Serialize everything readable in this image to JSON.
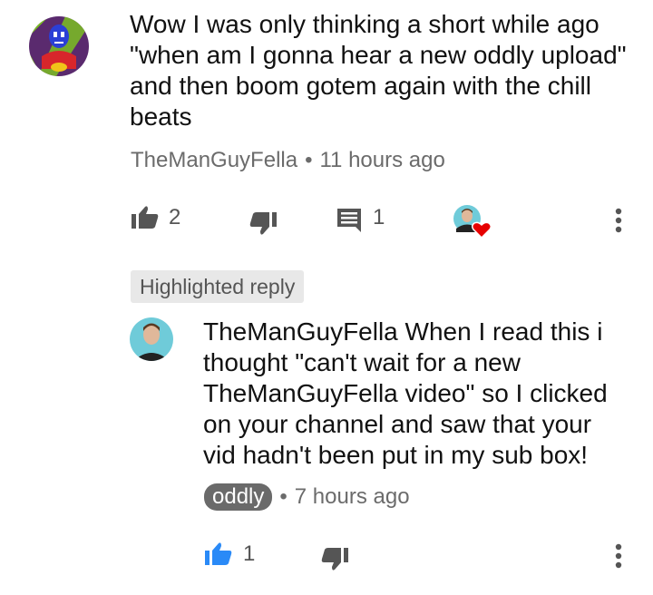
{
  "comment": {
    "text": "Wow I was only thinking a short while ago \"when am I gonna hear a new oddly upload\" and then boom gotem again with the chill beats",
    "author": "TheManGuyFella",
    "separator": "•",
    "time": "11 hours ago",
    "likes": "2",
    "replies": "1"
  },
  "highlighted_label": "Highlighted reply",
  "reply": {
    "author": "TheManGuyFella",
    "text": "When I read this i thought \"can't wait for a new TheManGuyFella video\" so I clicked on your channel and saw that your vid hadn't been put in my sub box!",
    "creator_chip": "oddly",
    "separator": "•",
    "time": "7 hours ago",
    "likes": "1"
  },
  "colors": {
    "like_active": "#2a8af7",
    "heart": "#e60000",
    "icon_gray": "#555555"
  }
}
